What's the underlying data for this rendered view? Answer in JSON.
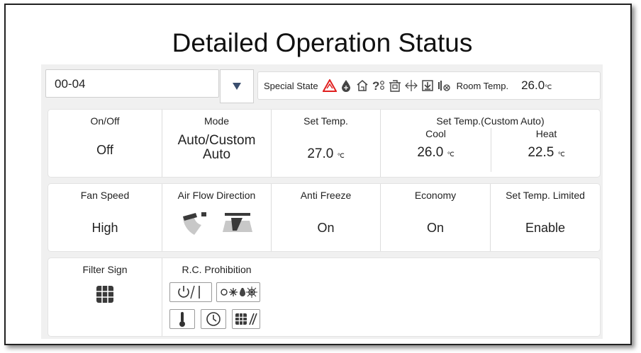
{
  "title": "Detailed Operation Status",
  "unit": "℃",
  "topbar": {
    "unit_select": {
      "value": "00-04",
      "dropdown_icon": "triangle-down-icon"
    },
    "special_state_label": "Special State",
    "special_icons": [
      {
        "name": "error-warning-icon",
        "glyph": "⚠",
        "color": "#e02020"
      },
      {
        "name": "defrost-icon",
        "glyph": "❄"
      },
      {
        "name": "home-icon",
        "glyph": "⌂"
      },
      {
        "name": "unknown-status-icon",
        "glyph": "?"
      },
      {
        "name": "building-icon",
        "glyph": "▣"
      },
      {
        "name": "airflow-icon",
        "glyph": "◇"
      },
      {
        "name": "download-icon",
        "glyph": "⬇"
      },
      {
        "name": "power-plug-icon",
        "glyph": "⏚"
      }
    ],
    "room_temp_label": "Room Temp.",
    "room_temp_value": "26.0"
  },
  "row1": {
    "onoff_label": "On/Off",
    "onoff_value": "Off",
    "mode_label": "Mode",
    "mode_value_line1": "Auto/Custom",
    "mode_value_line2": "Auto",
    "set_temp_label": "Set Temp.",
    "set_temp_value": "27.0",
    "custom_auto_label": "Set Temp.(Custom Auto)",
    "cool_label": "Cool",
    "cool_value": "26.0",
    "heat_label": "Heat",
    "heat_value": "22.5"
  },
  "row2": {
    "fan_speed_label": "Fan Speed",
    "fan_speed_value": "High",
    "air_flow_label": "Air Flow Direction",
    "anti_freeze_label": "Anti Freeze",
    "anti_freeze_value": "On",
    "economy_label": "Economy",
    "economy_value": "On",
    "temp_limited_label": "Set Temp. Limited",
    "temp_limited_value": "Enable"
  },
  "row3": {
    "filter_sign_label": "Filter Sign",
    "rc_prohibition_label": "R.C. Prohibition"
  }
}
